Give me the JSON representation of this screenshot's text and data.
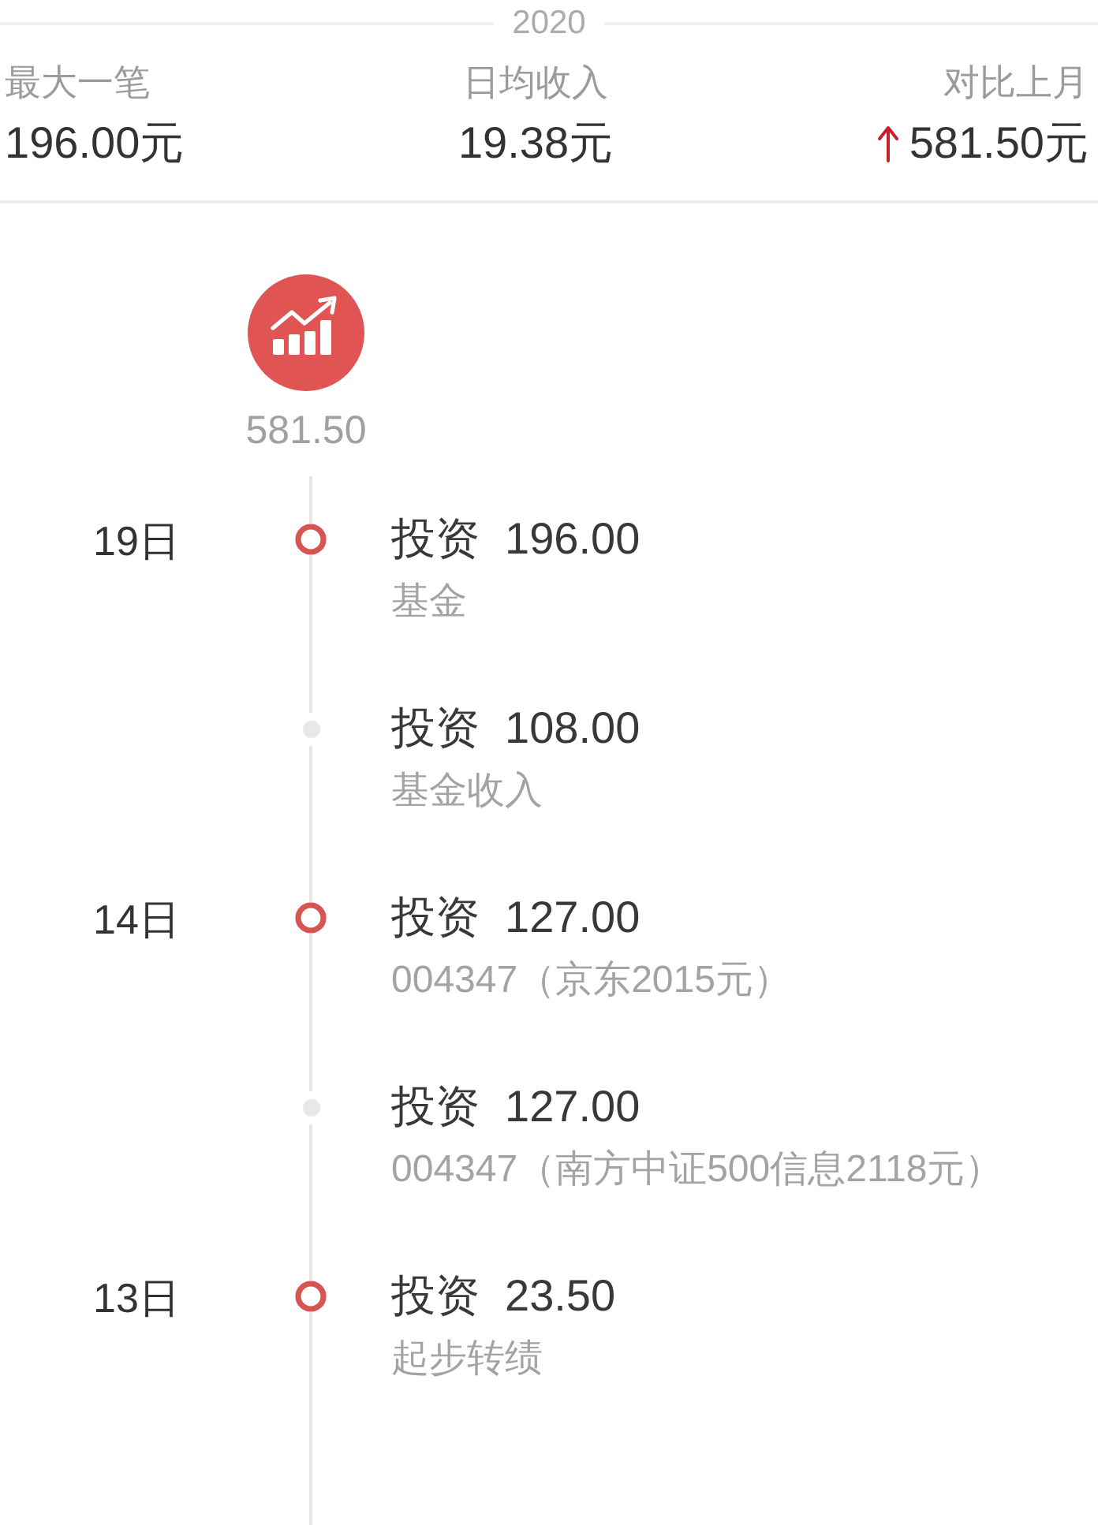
{
  "year_divider": {
    "label": "2020"
  },
  "stats": [
    {
      "label": "最大一笔",
      "value": "196.00元"
    },
    {
      "label": "日均收入",
      "value": "19.38元"
    },
    {
      "label": "对比上月",
      "value": "581.50元",
      "increase": true
    }
  ],
  "summary": {
    "amount": "581.50"
  },
  "entries": [
    {
      "kind": "day_start",
      "date": "19日",
      "category": "投资",
      "amount": "196.00",
      "note": "基金"
    },
    {
      "kind": "same_day",
      "category": "投资",
      "amount": "108.00",
      "note": "基金收入"
    },
    {
      "kind": "day_start",
      "date": "14日",
      "category": "投资",
      "amount": "127.00",
      "note": "004347（京东2015元）"
    },
    {
      "kind": "same_day",
      "category": "投资",
      "amount": "127.00",
      "note": "004347（南方中证500信息2118元）"
    },
    {
      "kind": "day_start",
      "date": "13日",
      "category": "投资",
      "amount": "23.50",
      "note": "起步转绩"
    }
  ]
}
